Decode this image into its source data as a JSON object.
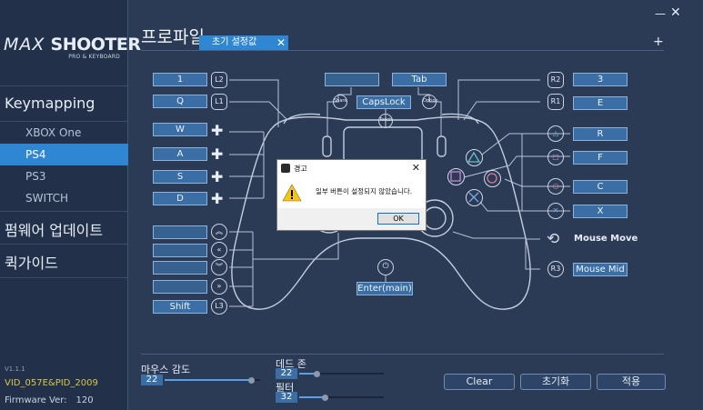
{
  "sidebar": {
    "logo_main_a": "MAX",
    "logo_main_b": " SHOOTER",
    "logo_sub": "PRO & KEYBOARD",
    "section_keymapping": "Keymapping",
    "items": [
      {
        "label": "XBOX One",
        "active": false
      },
      {
        "label": "PS4",
        "active": true
      },
      {
        "label": "PS3",
        "active": false
      },
      {
        "label": "SWITCH",
        "active": false
      }
    ],
    "section_firmware": "펌웨어 업데이트",
    "section_quickguide": "퀵가이드",
    "version": "V1.1.1",
    "vid_pid": "VID_057E&PID_2009",
    "firmware_label": "Firmware Ver:",
    "firmware_value": "120"
  },
  "header": {
    "title": "프로파일",
    "tab_label": "초기 설정값",
    "tab_close": "✕",
    "add_tab": "+",
    "minimize": "—",
    "close": "✕"
  },
  "icons": {
    "l2": "L2",
    "l1": "L1",
    "r2": "R2",
    "r1": "R1",
    "l3": "L3",
    "r3": "R3",
    "share": "Share",
    "option": "Option",
    "touch": "Touch"
  },
  "mapping": {
    "l2_key": "1",
    "l1_key": "Q",
    "dpad_up_key": "W",
    "dpad_left_key": "A",
    "dpad_down_key": "S",
    "dpad_right_key": "D",
    "stick_up_key": "",
    "stick_left_key": "",
    "stick_down_key": "",
    "stick_right_key": "",
    "l3_key": "Shift",
    "share_key": "",
    "option_key": "Tab",
    "touch_key": "CapsLock",
    "ps_key": "Enter(main)",
    "r2_key": "3",
    "r1_key": "E",
    "triangle_key": "R",
    "square_key": "F",
    "circle_key": "C",
    "cross_key": "X",
    "mouse_move_label": "Mouse Move",
    "r3_key": "Mouse Mid"
  },
  "dialog": {
    "title": "경고",
    "close": "✕",
    "message": "일부 버튼이 설정되지 않았습니다.",
    "ok": "OK"
  },
  "bottom": {
    "mouse_sens_label": "마우스 감도",
    "mouse_sens_value": "22",
    "mouse_sens_fraction": 0.9,
    "deadzone_label": "데드 존",
    "deadzone_value": "22",
    "deadzone_fraction": 0.2,
    "filter_label": "필터",
    "filter_value": "32",
    "filter_fraction": 0.3,
    "clear": "Clear",
    "reset": "초기화",
    "apply": "적용"
  },
  "colors": {
    "background": "#2b3a55",
    "sidebar": "#22304a",
    "accent": "#2f86d3",
    "key_box": "#3a6ea5",
    "vid_text": "#d7c84a"
  }
}
